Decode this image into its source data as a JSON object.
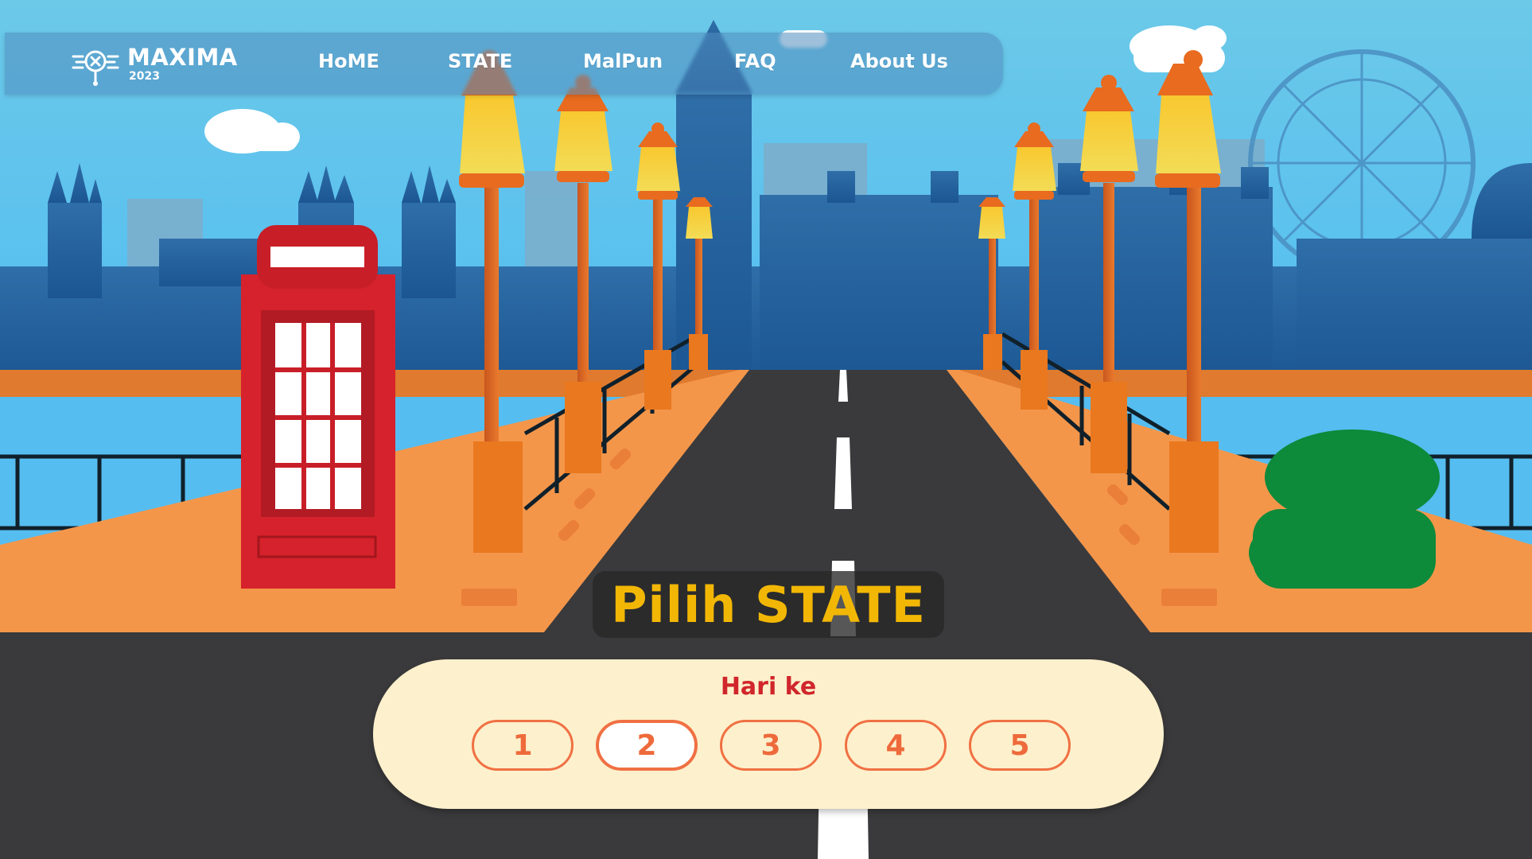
{
  "brand": {
    "name": "MAXIMA",
    "year": "2023"
  },
  "nav": {
    "items": [
      {
        "label": "HoME"
      },
      {
        "label": "STATE"
      },
      {
        "label": "MalPun"
      },
      {
        "label": "FAQ"
      },
      {
        "label": "About Us"
      }
    ]
  },
  "main": {
    "title": "Pilih STATE",
    "day_picker": {
      "label": "Hari ke",
      "options": [
        "1",
        "2",
        "3",
        "4",
        "5"
      ],
      "selected": "2"
    }
  },
  "colors": {
    "sky": "#5ec3ef",
    "road": "#3a3a3c",
    "sidewalk": "#f4964a",
    "title": "#f2b705",
    "panel": "#fdf0cc",
    "day_label": "#d0262b",
    "day_button": "#f07043",
    "phone_booth": "#d6222c",
    "bush": "#0d8a3a"
  },
  "icons": {
    "logo": "maxima-logo-icon"
  }
}
